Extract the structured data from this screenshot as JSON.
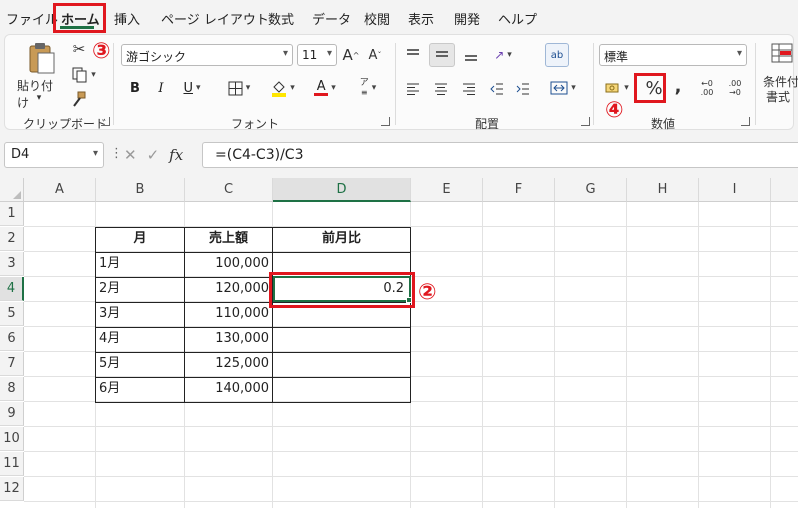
{
  "menu": {
    "items": [
      "ファイル",
      "ホーム",
      "挿入",
      "ページ レイアウト",
      "数式",
      "データ",
      "校閲",
      "表示",
      "開発",
      "ヘルプ"
    ],
    "active_index": 1
  },
  "ribbon": {
    "clipboard": {
      "paste_label": "貼り付け",
      "group_label": "クリップボード"
    },
    "font": {
      "font_name": "游ゴシック",
      "font_size": "11",
      "grow_label": "A",
      "shrink_label": "A",
      "bold_label": "B",
      "italic_label": "I",
      "underline_label": "U",
      "font_color_letter": "A",
      "phonetic_label": "ア",
      "group_label": "フォント",
      "highlight_color": "#ffe600",
      "font_color": "#e0171e"
    },
    "alignment": {
      "group_label": "配置",
      "wrap_label": "ab"
    },
    "number": {
      "format_value": "標準",
      "percent_label": "%",
      "comma_label": ",",
      "inc_decimal_label": ".00",
      "dec_decimal_label": ".00",
      "group_label": "数値"
    },
    "styles": {
      "conditional_label_1": "条件付",
      "conditional_label_2": "書式"
    }
  },
  "formula_bar": {
    "name_box": "D4",
    "formula": "=(C4-C3)/C3",
    "fx_label": "fx"
  },
  "sheet": {
    "columns": [
      "A",
      "B",
      "C",
      "D",
      "E",
      "F",
      "G",
      "H",
      "I"
    ],
    "selected_column": "D",
    "rows": [
      "1",
      "2",
      "3",
      "4",
      "5",
      "6",
      "7",
      "8",
      "9",
      "10",
      "11",
      "12"
    ],
    "selected_row": "4",
    "table": {
      "headers": [
        "月",
        "売上額",
        "前月比"
      ],
      "rows": [
        {
          "month": "1月",
          "sales": "100,000",
          "ratio": ""
        },
        {
          "month": "2月",
          "sales": "120,000",
          "ratio": "0.2"
        },
        {
          "month": "3月",
          "sales": "110,000",
          "ratio": ""
        },
        {
          "month": "4月",
          "sales": "130,000",
          "ratio": ""
        },
        {
          "month": "5月",
          "sales": "125,000",
          "ratio": ""
        },
        {
          "month": "6月",
          "sales": "140,000",
          "ratio": ""
        }
      ]
    }
  },
  "annotations": {
    "step2": "②",
    "step3": "③",
    "step4": "④",
    "color": "#e0171e"
  },
  "theme": {
    "accent": "#1e7145"
  }
}
